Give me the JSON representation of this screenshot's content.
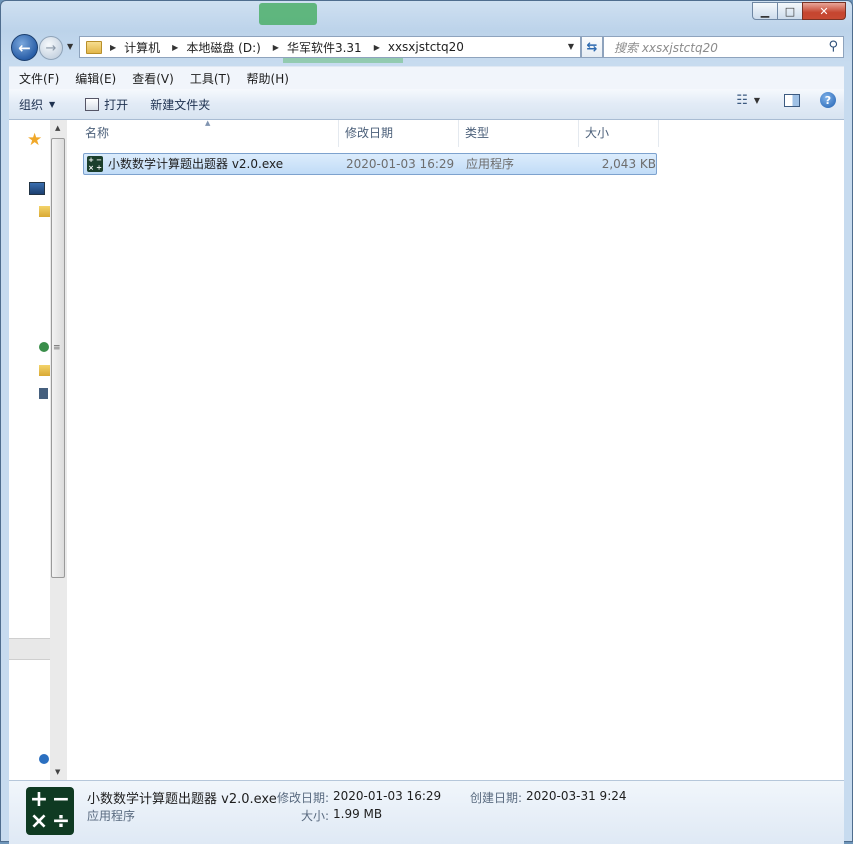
{
  "window": {
    "controls": {
      "minimize_icon": "minimize-icon",
      "maximize_icon": "maximize-icon",
      "close_icon": "close-icon"
    }
  },
  "address_bar": {
    "breadcrumbs": [
      "计算机",
      "本地磁盘 (D:)",
      "华军软件3.31",
      "xxsxjstctq20"
    ]
  },
  "search": {
    "placeholder": "搜索 xxsxjstctq20"
  },
  "menu": [
    "文件(F)",
    "编辑(E)",
    "查看(V)",
    "工具(T)",
    "帮助(H)"
  ],
  "toolbar": {
    "organize": "组织",
    "open": "打开",
    "new_folder": "新建文件夹"
  },
  "columns": {
    "name": "名称",
    "modified": "修改日期",
    "type": "类型",
    "size": "大小"
  },
  "files": [
    {
      "name": "小数数学计算题出题器 v2.0.exe",
      "modified": "2020-01-03 16:29",
      "type": "应用程序",
      "size": "2,043 KB"
    }
  ],
  "details": {
    "name": "小数数学计算题出题器 v2.0.exe",
    "type": "应用程序",
    "modified_label": "修改日期:",
    "modified_value": "2020-01-03 16:29",
    "created_label": "创建日期:",
    "created_value": "2020-03-31 9:24",
    "size_label": "大小:",
    "size_value": "1.99 MB"
  },
  "colors": {
    "accent": "#2a5fa8",
    "selection": "#c1dcf7",
    "app_icon": "#1b3f2c"
  }
}
